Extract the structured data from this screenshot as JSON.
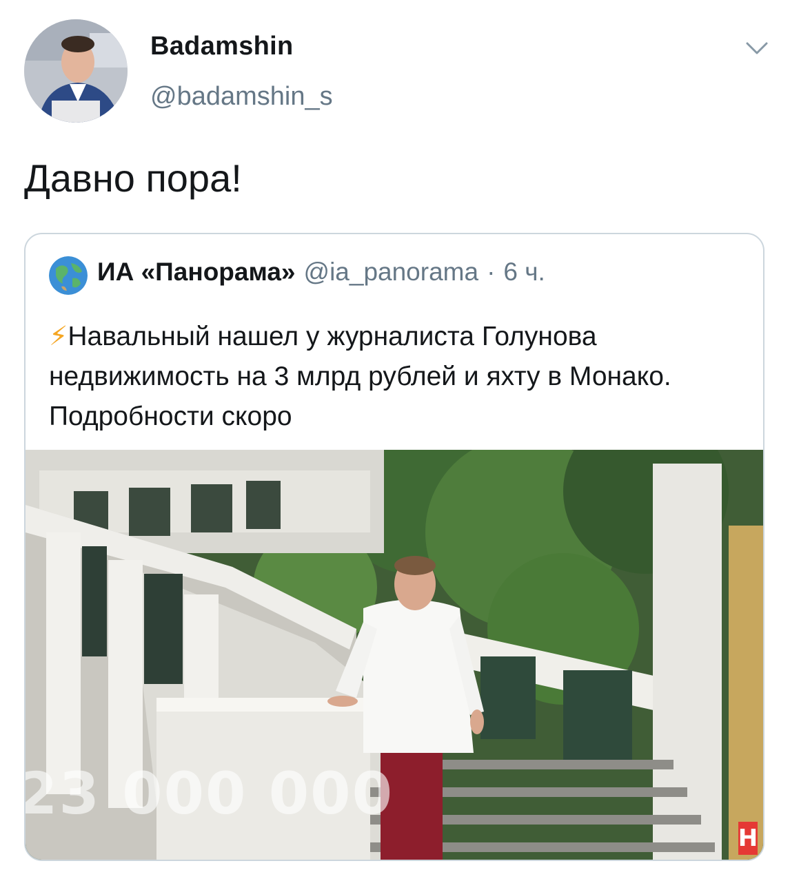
{
  "author": {
    "display_name": "Badamshin",
    "handle": "@badamshin_s"
  },
  "tweet": {
    "text": "Давно пора!"
  },
  "menu": {
    "icon": "chevron-down-icon"
  },
  "quoted": {
    "name": "ИА «Панорама»",
    "handle": "@ia_panorama",
    "separator": "·",
    "time": "6 ч.",
    "avatar_icon": "globe-icon",
    "emoji": "⚡",
    "text": "Навальный нашел у журналиста Голунова недвижимость на 3 млрд рублей и яхту в Монако. Подробности скоро",
    "media": {
      "overlay_text": "23 000 000",
      "logo_letter": "Н"
    }
  }
}
